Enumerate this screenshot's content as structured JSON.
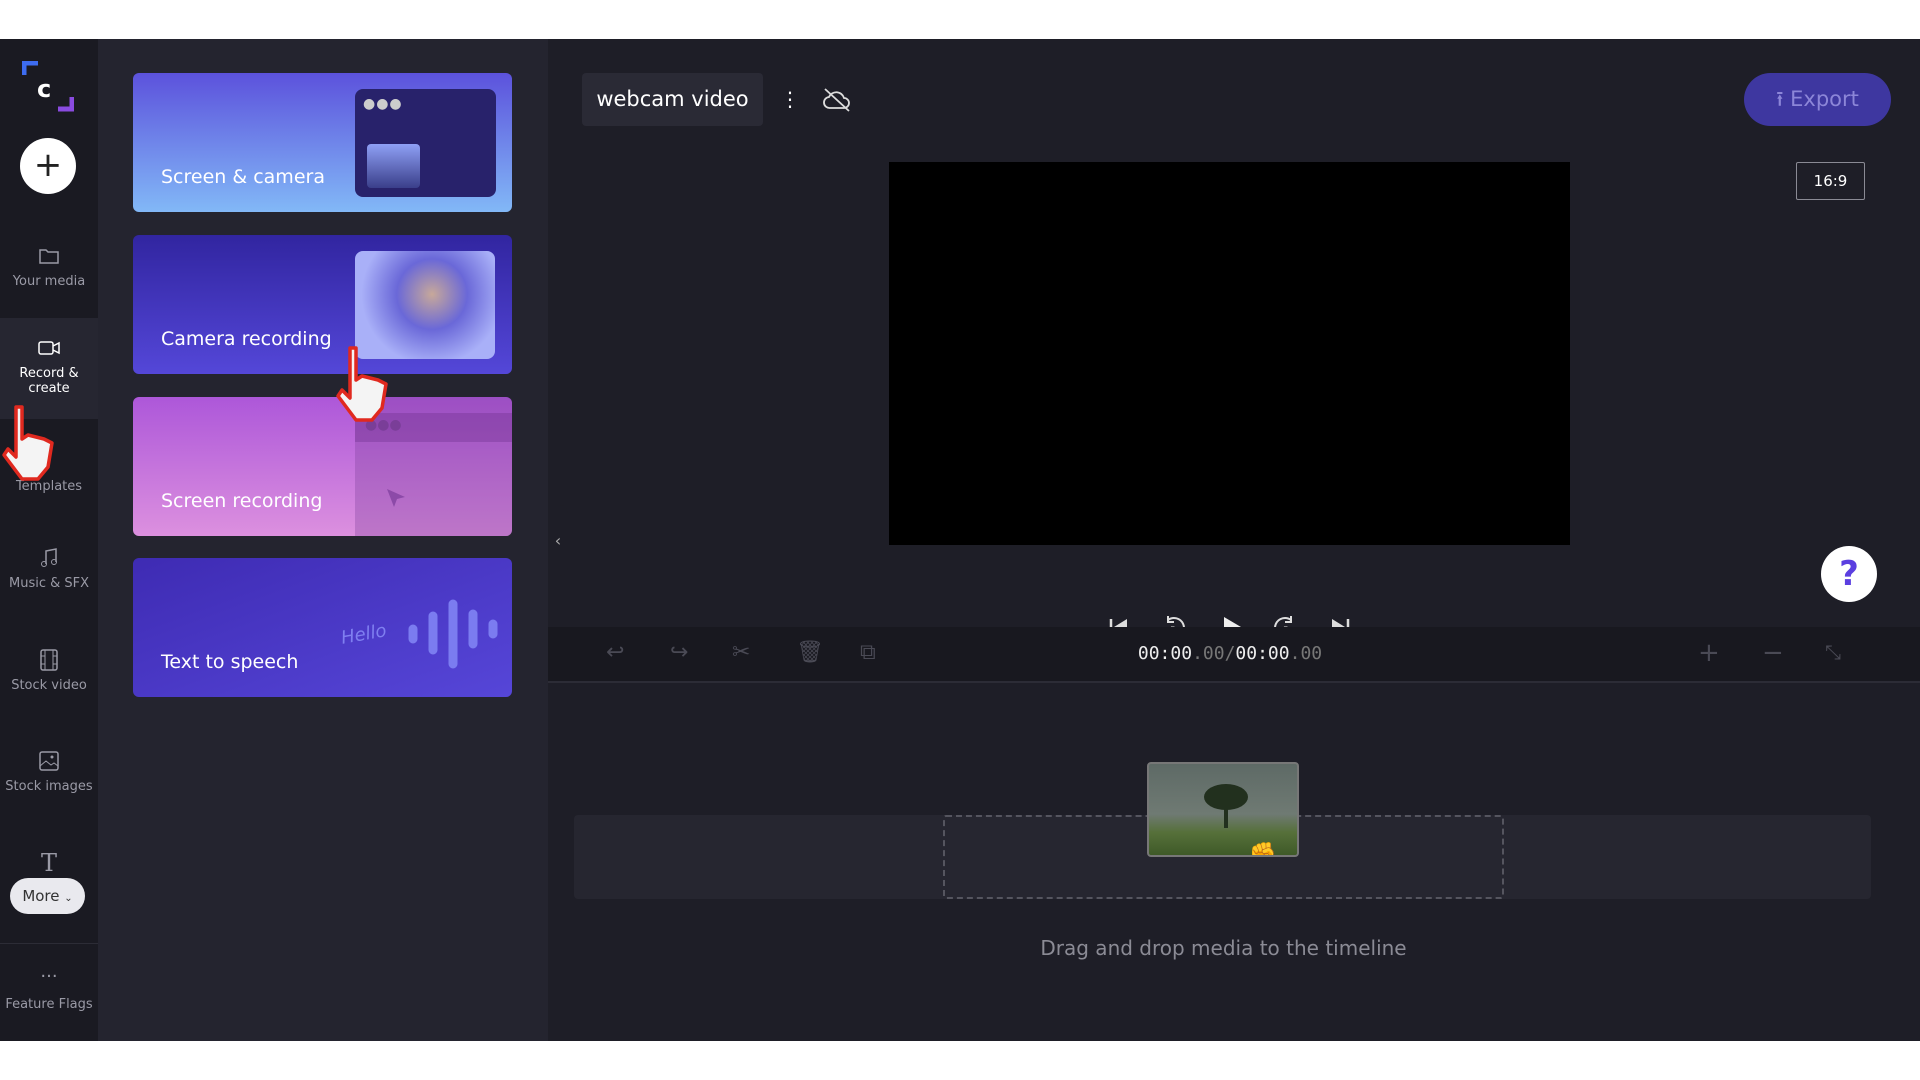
{
  "sidebar": {
    "items": [
      {
        "label": "Your media",
        "icon": "folder-icon"
      },
      {
        "label": "Record & create",
        "icon": "video-camera-icon",
        "active": true
      },
      {
        "label": "Templates",
        "icon": "templates-icon"
      },
      {
        "label": "Music & SFX",
        "icon": "music-note-icon"
      },
      {
        "label": "Stock video",
        "icon": "film-icon"
      },
      {
        "label": "Stock images",
        "icon": "image-icon"
      },
      {
        "label": "",
        "icon": "text-icon"
      }
    ],
    "more_label": "More",
    "feature_flags_label": "Feature Flags"
  },
  "panel": {
    "cards": [
      {
        "label": "Screen & camera"
      },
      {
        "label": "Camera recording"
      },
      {
        "label": "Screen recording"
      },
      {
        "label": "Text to speech",
        "art_text": "Hello"
      }
    ]
  },
  "header": {
    "project_title": "webcam video",
    "export_label": "Export",
    "aspect_ratio": "16:9"
  },
  "timeline": {
    "current_time": "00:00",
    "current_frac": ".00",
    "separator": "/",
    "total_time": "00:00",
    "total_frac": ".00",
    "empty_message": "Drag and drop media to the timeline"
  },
  "colors": {
    "accent": "#5b4bdb",
    "background": "#1e1e27"
  }
}
